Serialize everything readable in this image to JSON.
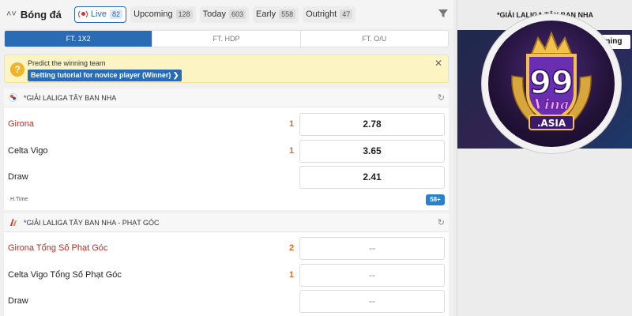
{
  "header": {
    "sport": "Bóng đá",
    "tabs": [
      {
        "label": "Live",
        "count": "82"
      },
      {
        "label": "Upcoming",
        "count": "128"
      },
      {
        "label": "Today",
        "count": "603"
      },
      {
        "label": "Early",
        "count": "558"
      },
      {
        "label": "Outright",
        "count": "47"
      }
    ]
  },
  "market_tabs": [
    "FT. 1X2",
    "FT. HDP",
    "FT. O/U"
  ],
  "notice": {
    "title": "Predict the winning team",
    "link": "Betting tutorial for novice player (Winner) ❯"
  },
  "leagues": [
    {
      "name": "*GIẢI LALIGA TÂY BAN NHA",
      "rows": [
        {
          "team": "Girona",
          "indicator": "1",
          "odd": "2.78"
        },
        {
          "team": "Celta Vigo",
          "indicator": "1",
          "odd": "3.65"
        },
        {
          "team": "Draw",
          "indicator": "",
          "odd": "2.41"
        }
      ],
      "time": "H.Time",
      "more": "58+"
    },
    {
      "name": "*GIẢI LALIGA TÂY BAN NHA - PHẠT GÓC",
      "rows": [
        {
          "team": "Girona Tổng Số Phạt Góc",
          "indicator": "2",
          "odd": "--"
        },
        {
          "team": "Celta Vigo Tổng Số Phạt Góc",
          "indicator": "1",
          "odd": "--"
        },
        {
          "team": "Draw",
          "indicator": "",
          "odd": "--"
        }
      ]
    }
  ],
  "right_panel": {
    "title": "*GIẢI LALIGA TÂY BAN NHA",
    "strip": "ming"
  },
  "logo": {
    "number": "99",
    "word": "Vina",
    "domain": ".ASIA"
  },
  "colors": {
    "accent": "#2a6bb5",
    "home_team": "#c8281e",
    "indicator": "#e36a1c",
    "notice_bg": "#fdf4c4"
  }
}
